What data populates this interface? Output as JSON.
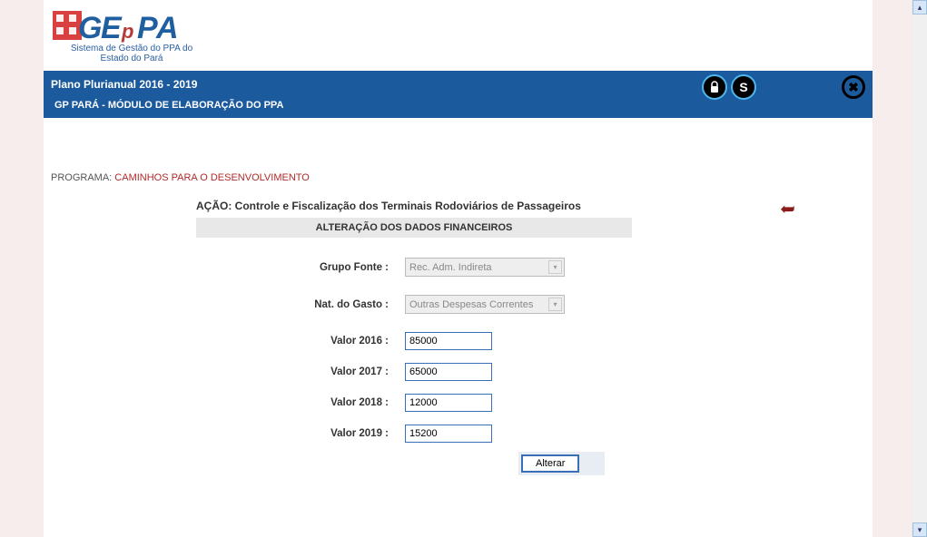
{
  "logo": {
    "subtitle_l1": "Sistema de Gestão do PPA do",
    "subtitle_l2": "Estado do Pará"
  },
  "header": {
    "title": "Plano Plurianual 2016 - 2019",
    "subtitle": "GP PARÁ - MÓDULO DE ELABORAÇÃO DO PPA",
    "icons": {
      "lock": "lock",
      "s": "S",
      "close": "close"
    }
  },
  "programa": {
    "label": "PROGRAMA:",
    "value": "CAMINHOS PARA O DESENVOLVIMENTO"
  },
  "acao": {
    "label": "AÇÃO:",
    "value": "Controle e Fiscalização dos Terminais Rodoviários de Passageiros"
  },
  "section_title": "ALTERAÇÃO DOS DADOS FINANCEIROS",
  "fields": {
    "grupo_fonte": {
      "label": "Grupo Fonte :",
      "value": "Rec. Adm. Indireta"
    },
    "nat_gasto": {
      "label": "Nat. do Gasto :",
      "value": "Outras Despesas Correntes"
    },
    "valor_2016": {
      "label": "Valor 2016 :",
      "value": "85000"
    },
    "valor_2017": {
      "label": "Valor 2017 :",
      "value": "65000"
    },
    "valor_2018": {
      "label": "Valor 2018 :",
      "value": "12000"
    },
    "valor_2019": {
      "label": "Valor 2019 :",
      "value": "15200"
    }
  },
  "buttons": {
    "alterar": "Alterar"
  }
}
